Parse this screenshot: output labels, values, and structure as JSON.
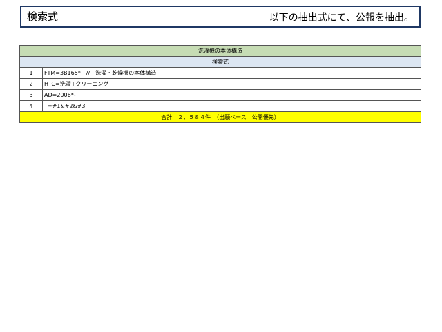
{
  "header": {
    "left_title": "検索式",
    "right_text": "以下の抽出式にて、公報を抽出。"
  },
  "table": {
    "title": "洗濯機の本体構造",
    "subtitle": "検索式",
    "rows": [
      {
        "num": "1",
        "expr": "FTM=3B165*　//　洗濯・乾燥機の本体構造"
      },
      {
        "num": "2",
        "expr": "HTC=洗濯+クリーニング"
      },
      {
        "num": "3",
        "expr": "AD=2006*-"
      },
      {
        "num": "4",
        "expr": "T=#1&#2&#3"
      }
    ],
    "total": "合計　２，５８４件　（出願ベース　公開優先）"
  }
}
